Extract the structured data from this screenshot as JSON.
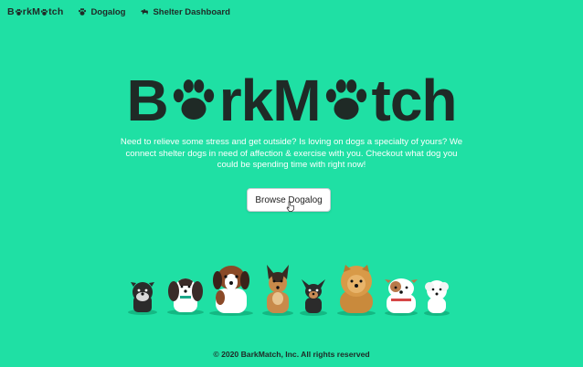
{
  "nav": {
    "brand_left": "B",
    "brand_mid": "rkM",
    "brand_right": "tch",
    "links": [
      {
        "label": "Dogalog",
        "icon": "paw-icon"
      },
      {
        "label": "Shelter Dashboard",
        "icon": "dog-icon"
      }
    ]
  },
  "hero": {
    "logo_left": "B",
    "logo_mid": "rkM",
    "logo_right": "tch",
    "description": "Need to relieve some stress and get outside? Is loving on dogs a specialty of yours? We connect shelter dogs in need of affection & exercise with you. Checkout what dog you could be spending time with right now!",
    "button_label": "Browse Dogalog"
  },
  "footer": {
    "text": "© 2020 BarkMatch, Inc. All rights reserved"
  },
  "colors": {
    "background": "#1fe0a4",
    "text": "#1f2a26",
    "button_bg": "#ffffff"
  }
}
